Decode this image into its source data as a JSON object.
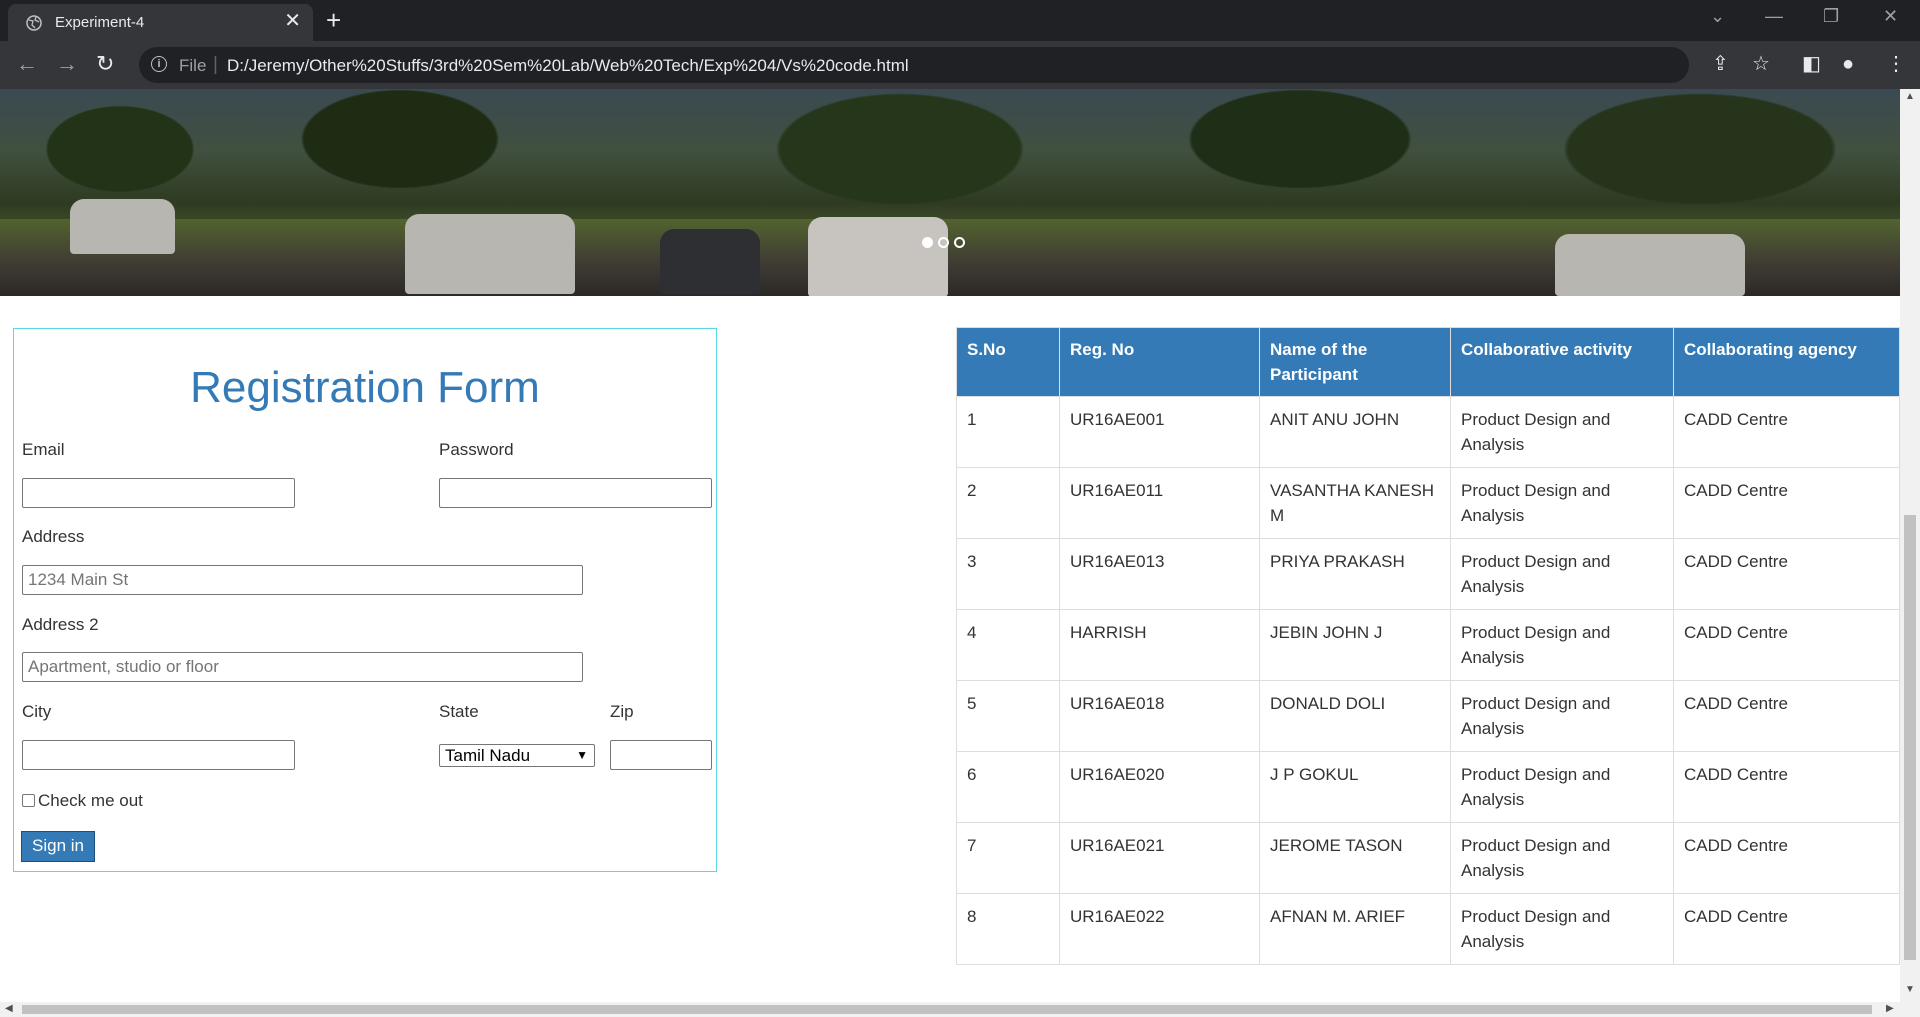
{
  "browser": {
    "tab_title": "Experiment-4",
    "url_scheme": "File",
    "url": "D:/Jeremy/Other%20Stuffs/3rd%20Sem%20Lab/Web%20Tech/Exp%204/Vs%20code.html"
  },
  "carousel": {
    "slides": 3,
    "active_index": 0
  },
  "form": {
    "title": "Registration Form",
    "email_label": "Email",
    "password_label": "Password",
    "address_label": "Address",
    "address_placeholder": "1234 Main St",
    "address2_label": "Address 2",
    "address2_placeholder": "Apartment, studio or floor",
    "city_label": "City",
    "state_label": "State",
    "state_value": "Tamil Nadu",
    "zip_label": "Zip",
    "check_label": "Check me out",
    "submit_label": "Sign in"
  },
  "table": {
    "headers": [
      "S.No",
      "Reg. No",
      "Name of the Participant",
      "Collaborative activity",
      "Collaborating agency"
    ],
    "rows": [
      [
        "1",
        "UR16AE001",
        "ANIT ANU JOHN",
        "Product Design and Analysis",
        "CADD Centre"
      ],
      [
        "2",
        "UR16AE011",
        "VASANTHA KANESH M",
        "Product Design and Analysis",
        "CADD Centre"
      ],
      [
        "3",
        "UR16AE013",
        "PRIYA PRAKASH",
        "Product Design and Analysis",
        "CADD Centre"
      ],
      [
        "4",
        "HARRISH",
        "JEBIN JOHN J",
        "Product Design and Analysis",
        "CADD Centre"
      ],
      [
        "5",
        "UR16AE018",
        "DONALD DOLI",
        "Product Design and Analysis",
        "CADD Centre"
      ],
      [
        "6",
        "UR16AE020",
        "J P GOKUL",
        "Product Design and Analysis",
        "CADD Centre"
      ],
      [
        "7",
        "UR16AE021",
        "JEROME TASON",
        "Product Design and Analysis",
        "CADD Centre"
      ],
      [
        "8",
        "UR16AE022",
        "AFNAN M. ARIEF",
        "Product Design and Analysis",
        "CADD Centre"
      ]
    ]
  }
}
